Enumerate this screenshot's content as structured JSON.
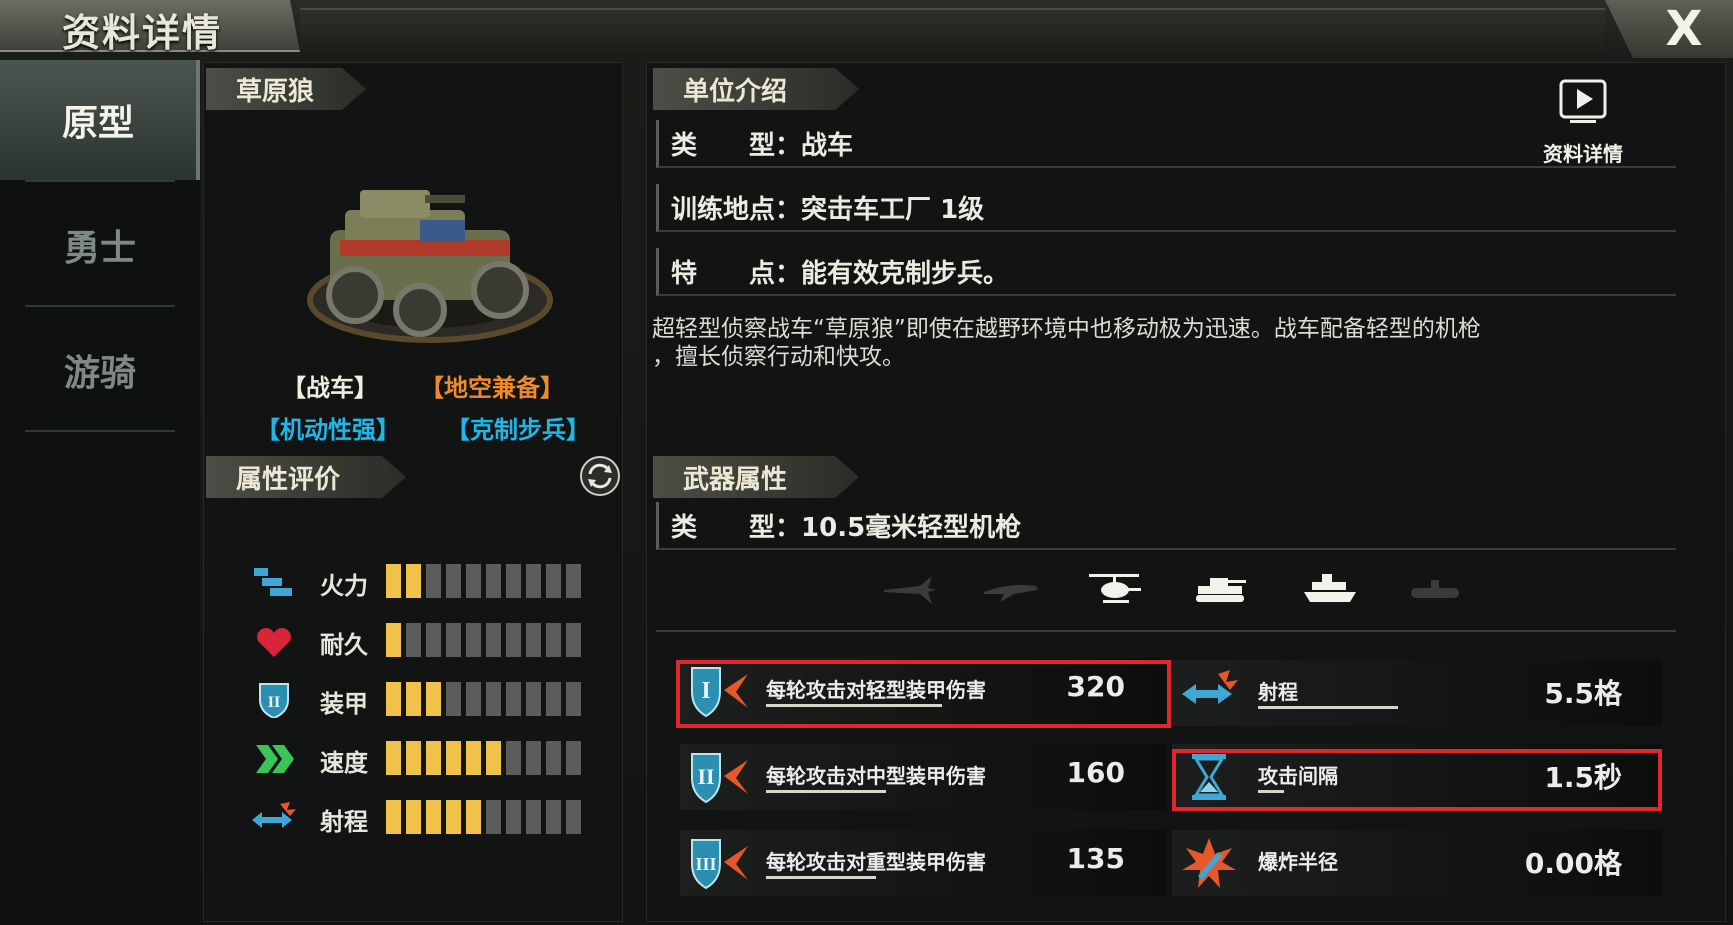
{
  "window": {
    "title": "资料详情",
    "close_label": "X"
  },
  "sidenav": {
    "items": [
      {
        "label": "原型",
        "active": true
      },
      {
        "label": "勇士",
        "active": false
      },
      {
        "label": "游骑",
        "active": false
      }
    ]
  },
  "unit": {
    "name": "草原狼",
    "tags": [
      {
        "label": "【战车】",
        "color": "#f0ece0"
      },
      {
        "label": "【地空兼备】",
        "color": "#f08a2a"
      },
      {
        "label": "【机动性强】",
        "color": "#1fb6e8"
      },
      {
        "label": "【克制步兵】",
        "color": "#1fb6e8"
      }
    ]
  },
  "attributes": {
    "heading": "属性评价",
    "max_bars": 10,
    "items": [
      {
        "label": "火力",
        "icon": "firepower-icon",
        "level": 2
      },
      {
        "label": "耐久",
        "icon": "heart-icon",
        "level": 1
      },
      {
        "label": "装甲",
        "icon": "armor-shield-icon",
        "level": 3
      },
      {
        "label": "速度",
        "icon": "speed-chevron-icon",
        "level": 6
      },
      {
        "label": "射程",
        "icon": "range-arrow-icon",
        "level": 5
      }
    ]
  },
  "intro": {
    "heading": "单位介绍",
    "detail_button": "资料详情",
    "rows": [
      {
        "label": "类　　型：",
        "value": "战车"
      },
      {
        "label": "训练地点：",
        "value": "突击车工厂 1级"
      },
      {
        "label": "特　　点：",
        "value": "能有效克制步兵。"
      }
    ],
    "description_line1": "超轻型侦察战车“草原狼”即使在越野环境中也移动极为迅速。战车配备轻型的机枪",
    "description_line2": "，擅长侦察行动和快攻。"
  },
  "weapon": {
    "heading": "武器属性",
    "type_label": "类　　型：",
    "type_value": "10.5毫米轻型机枪",
    "targets": [
      {
        "icon": "fighter-jet-icon",
        "active": false
      },
      {
        "icon": "bomber-icon",
        "active": false
      },
      {
        "icon": "helicopter-icon",
        "active": true
      },
      {
        "icon": "tank-icon",
        "active": true
      },
      {
        "icon": "ship-icon",
        "active": true
      },
      {
        "icon": "submarine-icon",
        "active": false
      }
    ],
    "stats": {
      "light": {
        "label": "每轮攻击对轻型装甲伤害",
        "value": "320"
      },
      "medium": {
        "label": "每轮攻击对中型装甲伤害",
        "value": "160"
      },
      "heavy": {
        "label": "每轮攻击对重型装甲伤害",
        "value": "135"
      },
      "range": {
        "label": "射程",
        "value": "5.5格"
      },
      "interval": {
        "label": "攻击间隔",
        "value": "1.5秒"
      },
      "radius": {
        "label": "爆炸半径",
        "value": "0.00格"
      }
    }
  }
}
